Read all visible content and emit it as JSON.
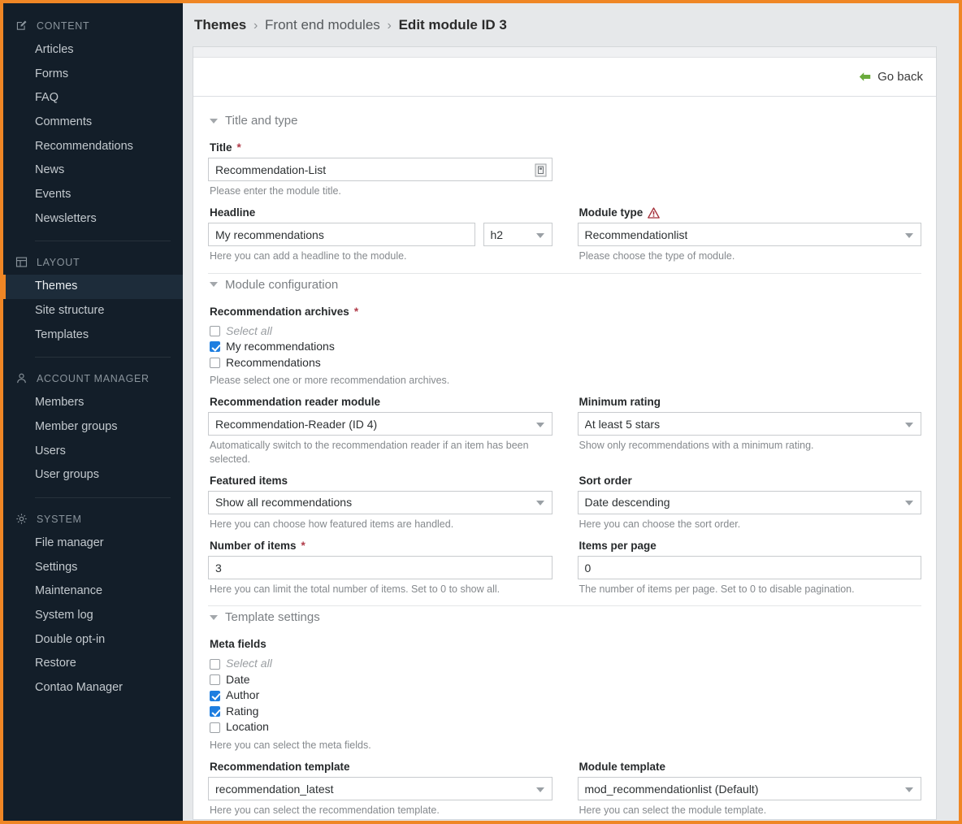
{
  "theme": {
    "accent": "#ef8625",
    "sidebar_bg": "#131e29",
    "checkbox_blue": "#1e7ee0",
    "warning_red": "#a4303a",
    "goback_green": "#6aab3c"
  },
  "sidebar": {
    "sections": [
      {
        "id": "content",
        "title": "CONTENT",
        "icon": "edit-square-icon",
        "items": [
          {
            "label": "Articles",
            "active": false
          },
          {
            "label": "Forms",
            "active": false
          },
          {
            "label": "FAQ",
            "active": false
          },
          {
            "label": "Comments",
            "active": false
          },
          {
            "label": "Recommendations",
            "active": false
          },
          {
            "label": "News",
            "active": false
          },
          {
            "label": "Events",
            "active": false
          },
          {
            "label": "Newsletters",
            "active": false
          }
        ]
      },
      {
        "id": "layout",
        "title": "LAYOUT",
        "icon": "layout-grid-icon",
        "items": [
          {
            "label": "Themes",
            "active": true
          },
          {
            "label": "Site structure",
            "active": false
          },
          {
            "label": "Templates",
            "active": false
          }
        ]
      },
      {
        "id": "account-manager",
        "title": "ACCOUNT MANAGER",
        "icon": "user-icon",
        "items": [
          {
            "label": "Members",
            "active": false
          },
          {
            "label": "Member groups",
            "active": false
          },
          {
            "label": "Users",
            "active": false
          },
          {
            "label": "User groups",
            "active": false
          }
        ]
      },
      {
        "id": "system",
        "title": "SYSTEM",
        "icon": "gear-icon",
        "items": [
          {
            "label": "File manager",
            "active": false
          },
          {
            "label": "Settings",
            "active": false
          },
          {
            "label": "Maintenance",
            "active": false
          },
          {
            "label": "System log",
            "active": false
          },
          {
            "label": "Double opt-in",
            "active": false
          },
          {
            "label": "Restore",
            "active": false
          },
          {
            "label": "Contao Manager",
            "active": false
          }
        ]
      }
    ]
  },
  "breadcrumb": {
    "root": "Themes",
    "middle": "Front end modules",
    "current": "Edit module ID 3",
    "separator": "›"
  },
  "panel": {
    "go_back_label": "Go back",
    "go_back_icon": "arrow-left-icon"
  },
  "fieldsets": {
    "title_and_type": {
      "legend": "Title and type"
    },
    "module_configuration": {
      "legend": "Module configuration"
    },
    "template_settings": {
      "legend": "Template settings"
    }
  },
  "fields": {
    "title": {
      "label": "Title",
      "required_marker": "*",
      "value": "Recommendation-List",
      "help": "Please enter the module title.",
      "button_icon": "text-store-icon"
    },
    "headline": {
      "label": "Headline",
      "value": "My recommendations",
      "tag_value": "h2",
      "help": "Here you can add a headline to the module."
    },
    "module_type": {
      "label": "Module type",
      "warning_icon": "warning-triangle-icon",
      "value": "Recommendationlist",
      "help": "Please choose the type of module."
    },
    "recommendation_archives": {
      "label": "Recommendation archives",
      "required_marker": "*",
      "options": [
        {
          "label": "Select all",
          "checked": false,
          "muted": true
        },
        {
          "label": "My recommendations",
          "checked": true,
          "muted": false
        },
        {
          "label": "Recommendations",
          "checked": false,
          "muted": false
        }
      ],
      "help": "Please select one or more recommendation archives."
    },
    "recommendation_reader_module": {
      "label": "Recommendation reader module",
      "value": "Recommendation-Reader (ID 4)",
      "help": "Automatically switch to the recommendation reader if an item has been selected."
    },
    "minimum_rating": {
      "label": "Minimum rating",
      "value": "At least 5 stars",
      "help": "Show only recommendations with a minimum rating."
    },
    "featured_items": {
      "label": "Featured items",
      "value": "Show all recommendations",
      "help": "Here you can choose how featured items are handled."
    },
    "sort_order": {
      "label": "Sort order",
      "value": "Date descending",
      "help": "Here you can choose the sort order."
    },
    "number_of_items": {
      "label": "Number of items",
      "required_marker": "*",
      "value": "3",
      "help": "Here you can limit the total number of items. Set to 0 to show all."
    },
    "items_per_page": {
      "label": "Items per page",
      "value": "0",
      "help": "The number of items per page. Set to 0 to disable pagination."
    },
    "meta_fields": {
      "label": "Meta fields",
      "options": [
        {
          "label": "Select all",
          "checked": false,
          "muted": true
        },
        {
          "label": "Date",
          "checked": false,
          "muted": false
        },
        {
          "label": "Author",
          "checked": true,
          "muted": false
        },
        {
          "label": "Rating",
          "checked": true,
          "muted": false
        },
        {
          "label": "Location",
          "checked": false,
          "muted": false
        }
      ],
      "help": "Here you can select the meta fields."
    },
    "recommendation_template": {
      "label": "Recommendation template",
      "value": "recommendation_latest",
      "help": "Here you can select the recommendation template."
    },
    "module_template": {
      "label": "Module template",
      "value": "mod_recommendationlist (Default)",
      "help": "Here you can select the module template."
    }
  }
}
